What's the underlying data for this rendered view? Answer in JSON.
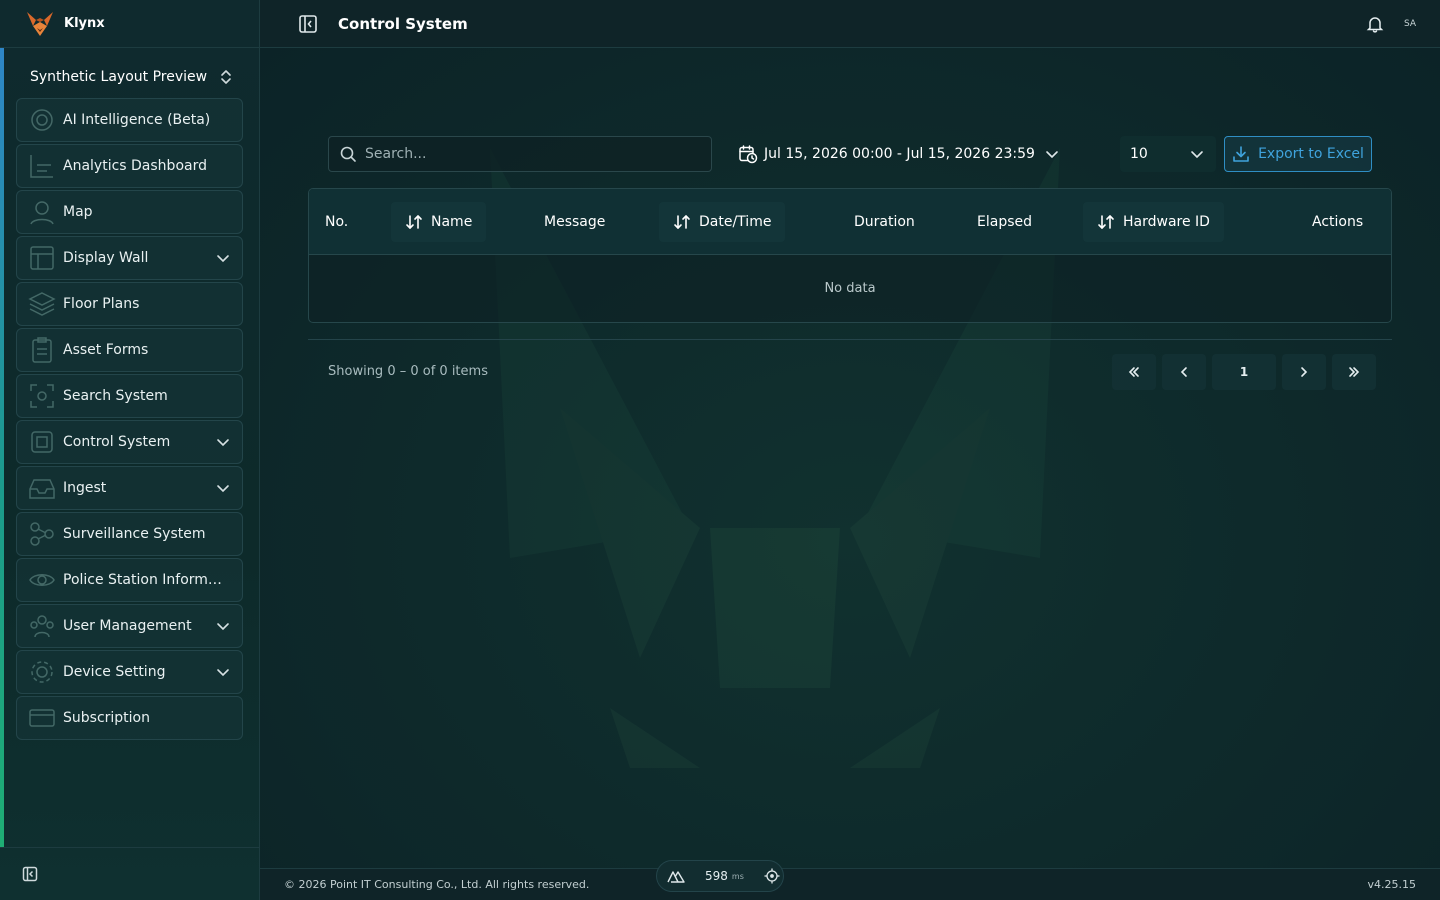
{
  "brand": {
    "name": "Klynx",
    "logo": "fox-logo-icon"
  },
  "sidebar": {
    "workspace": "Synthetic Layout Preview",
    "items": [
      {
        "label": "AI Intelligence (Beta)",
        "icon": "ai-icon",
        "expandable": false
      },
      {
        "label": "Analytics Dashboard",
        "icon": "chart-icon",
        "expandable": false
      },
      {
        "label": "Map",
        "icon": "map-pin-icon",
        "expandable": false
      },
      {
        "label": "Display Wall",
        "icon": "layout-icon",
        "expandable": true
      },
      {
        "label": "Floor Plans",
        "icon": "layers-icon",
        "expandable": false
      },
      {
        "label": "Asset Forms",
        "icon": "clipboard-icon",
        "expandable": false
      },
      {
        "label": "Search System",
        "icon": "scan-icon",
        "expandable": false
      },
      {
        "label": "Control System",
        "icon": "chip-icon",
        "expandable": true
      },
      {
        "label": "Ingest",
        "icon": "inbox-icon",
        "expandable": true
      },
      {
        "label": "Surveillance System",
        "icon": "network-icon",
        "expandable": false
      },
      {
        "label": "Police Station Informati...",
        "icon": "eye-icon",
        "expandable": false
      },
      {
        "label": "User Management",
        "icon": "users-icon",
        "expandable": true
      },
      {
        "label": "Device Setting",
        "icon": "gear-icon",
        "expandable": true
      },
      {
        "label": "Subscription",
        "icon": "card-icon",
        "expandable": false
      }
    ]
  },
  "header": {
    "title": "Control System",
    "avatar": "SA"
  },
  "toolbar": {
    "search_placeholder": "Search...",
    "date_range": "Jul 15, 2026 00:00 - Jul 15, 2026 23:59",
    "page_size": "10",
    "export_label": "Export to Excel"
  },
  "table": {
    "columns": {
      "no": "No.",
      "name": "Name",
      "message": "Message",
      "datetime": "Date/Time",
      "duration": "Duration",
      "elapsed": "Elapsed",
      "hardware_id": "Hardware ID",
      "actions": "Actions"
    },
    "empty_text": "No data",
    "rows": []
  },
  "pagination": {
    "summary": "Showing 0 – 0 of 0 items",
    "current_page": "1"
  },
  "footer": {
    "copyright": "© 2026 Point IT Consulting Co., Ltd. All rights reserved.",
    "version": "v4.25.15"
  },
  "perf": {
    "value": "598",
    "unit": "ms"
  },
  "colors": {
    "accent": "#3fa3dd",
    "background": "#0d2226"
  }
}
